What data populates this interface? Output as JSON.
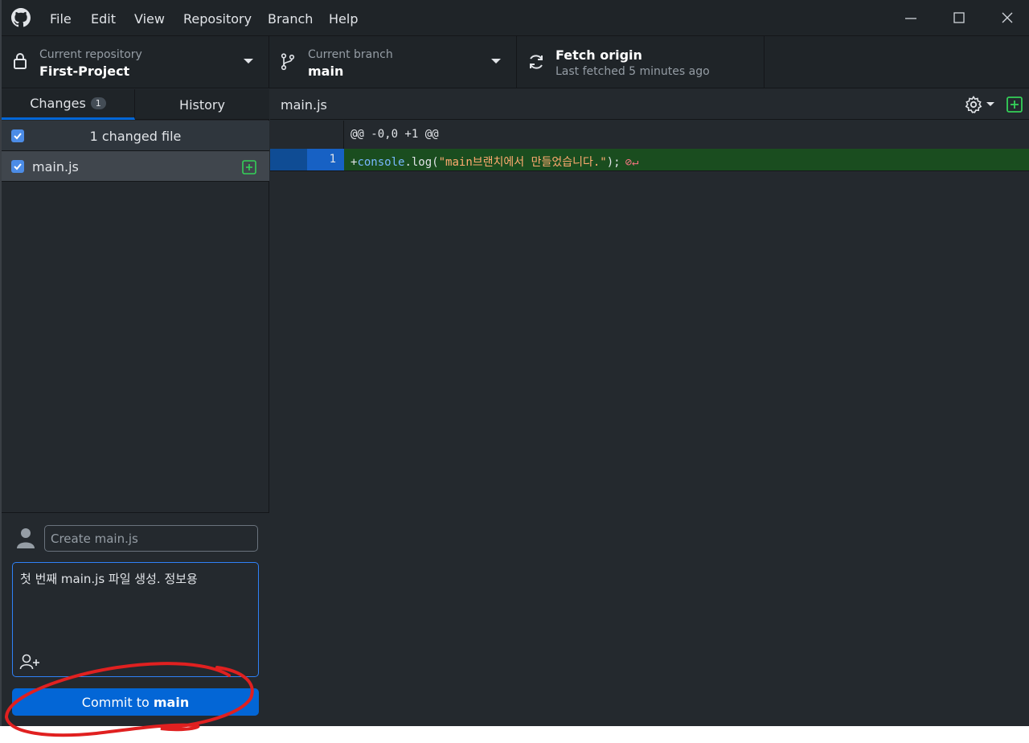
{
  "menu": [
    "File",
    "Edit",
    "View",
    "Repository",
    "Branch",
    "Help"
  ],
  "toolbar": {
    "repo_label": "Current repository",
    "repo_name": "First-Project",
    "branch_label": "Current branch",
    "branch_name": "main",
    "fetch_title": "Fetch origin",
    "fetch_sub": "Last fetched 5 minutes ago"
  },
  "tabs": {
    "changes": "Changes",
    "changes_count": "1",
    "history": "History"
  },
  "changes": {
    "header": "1 changed file",
    "file_name": "main.js"
  },
  "commit": {
    "summary_placeholder": "Create main.js",
    "description": "첫 번째 main.js 파일 생성. 정보용",
    "button_prefix": "Commit to ",
    "button_branch": "main"
  },
  "diff": {
    "file_name": "main.js",
    "hunk": "@@ -0,0 +1 @@",
    "line_number": "1",
    "line_plus": "+",
    "line_object": "console",
    "line_method": ".log(",
    "line_string_kw": "\"main",
    "line_string_rest": "브랜치에서 만들었습니다.\"",
    "line_end": ");",
    "line_symbols": "⊘↵"
  },
  "icons": [
    "github-logo-icon",
    "lock-icon",
    "branch-icon",
    "sync-icon",
    "gear-icon",
    "add-file-icon",
    "person-icon",
    "add-coauthor-icon",
    "checkbox-icon"
  ],
  "colors": {
    "accent": "#0366d6",
    "added_row": "#1a4d1f",
    "annotation": "#e02020"
  }
}
